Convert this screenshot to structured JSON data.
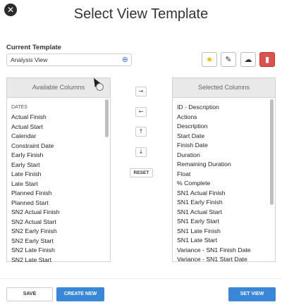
{
  "dialog": {
    "title": "Select View Template",
    "close_glyph": "✕"
  },
  "current_template": {
    "label": "Current Template",
    "value": "Analysis View",
    "icon": "globe-icon"
  },
  "toolbar": {
    "favorite_icon": "star-icon",
    "edit_icon": "edit-icon",
    "upload_icon": "cloud-upload-icon",
    "delete_icon": "trash-icon",
    "delete_color": "#d9534f",
    "favorite_color": "#f2b400"
  },
  "available": {
    "header": "Available Columns",
    "group": "DATES",
    "items": [
      "Actual Finish",
      "Actual Start",
      "Calendar",
      "Constraint Date",
      "Early Finish",
      "Early Start",
      "Late Finish",
      "Late Start",
      "Planned Finish",
      "Planned Start",
      "SN2 Actual Finish",
      "SN2 Actual Start",
      "SN2 Early Finish",
      "SN2 Early Start",
      "SN2 Late Finish",
      "SN2 Late Start"
    ]
  },
  "selected": {
    "header": "Selected Columns",
    "items": [
      "ID - Description",
      "Actions",
      "Description",
      "Start Date",
      "Finish Date",
      "Duration",
      "Remaining Duration",
      "Float",
      "% Complete",
      "SN1 Actual Finish",
      "SN1 Early Finish",
      "SN1 Actual Start",
      "SN1 Early Start",
      "SN1 Late Finish",
      "SN1 Late Start",
      "Variance - SN1 Finish Date",
      "Variance - SN1 Start Date"
    ]
  },
  "move_controls": {
    "right": "→",
    "left": "←",
    "up": "↑",
    "down": "↓",
    "reset": "RESET"
  },
  "footer": {
    "save": "SAVE",
    "create_new": "CREATE NEW",
    "set_view": "SET VIEW",
    "accent": "#3a87d8"
  }
}
